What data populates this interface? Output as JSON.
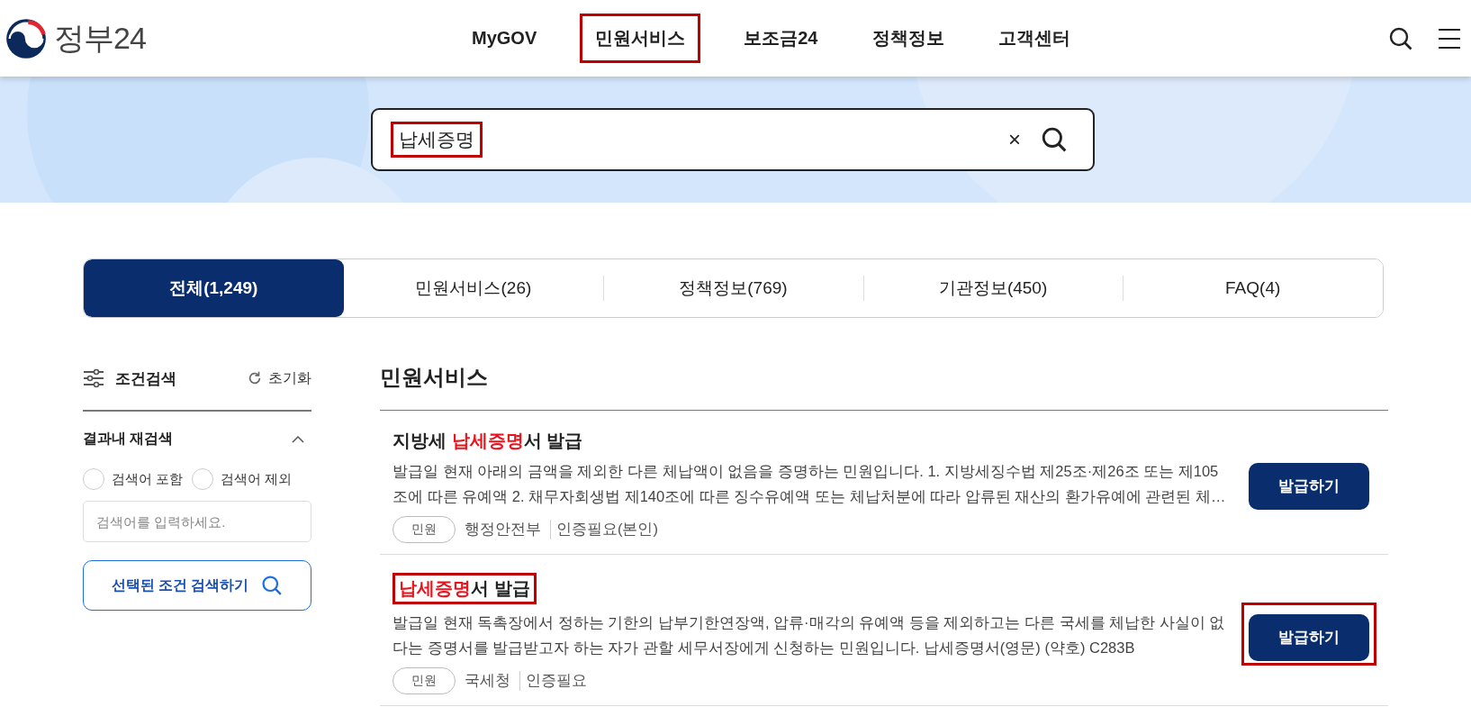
{
  "header": {
    "logo_text": "정부24",
    "nav": [
      {
        "label": "MyGOV",
        "highlighted": false
      },
      {
        "label": "민원서비스",
        "highlighted": true
      },
      {
        "label": "보조금24",
        "highlighted": false
      },
      {
        "label": "정책정보",
        "highlighted": false
      },
      {
        "label": "고객센터",
        "highlighted": false
      }
    ]
  },
  "search": {
    "value": "납세증명",
    "highlighted": true,
    "clear": "×"
  },
  "tabs": [
    {
      "label": "전체(1,249)",
      "selected": true
    },
    {
      "label": "민원서비스(26)",
      "selected": false
    },
    {
      "label": "정책정보(769)",
      "selected": false
    },
    {
      "label": "기관정보(450)",
      "selected": false
    },
    {
      "label": "FAQ(4)",
      "selected": false
    }
  ],
  "filter": {
    "title": "조건검색",
    "reset": "초기화",
    "section": "결과내 재검색",
    "expanded": true,
    "options": [
      {
        "label": "검색어 포함",
        "selected": false
      },
      {
        "label": "검색어 제외",
        "selected": false
      }
    ],
    "placeholder": "검색어를 입력하세요.",
    "button": "선택된 조건 검색하기"
  },
  "results": {
    "heading": "민원서비스",
    "items": [
      {
        "title": [
          {
            "text": "지방세 ",
            "match": false
          },
          {
            "text": "납세증명",
            "match": true
          },
          {
            "text": "서 발급",
            "match": false
          }
        ],
        "title_highlighted": false,
        "description": "발급일 현재 아래의 금액을 제외한 다른 체납액이 없음을 증명하는 민원입니다. 1. 지방세징수법 제25조·제26조 또는 제105조에 따른 유예액 2. 채무자회생법 제140조에 따른 징수유예액 또는 체납처분에 따라 압류된 재산의 환가유예에 관련된 체…",
        "tag": "민원",
        "agency": "행정안전부",
        "auth": "인증필요(본인)",
        "button": "발급하기",
        "button_highlighted": false
      },
      {
        "title": [
          {
            "text": "납세증명",
            "match": true
          },
          {
            "text": "서 발급",
            "match": false
          }
        ],
        "title_highlighted": true,
        "description": "발급일 현재 독촉장에서 정하는 기한의 납부기한연장액, 압류·매각의 유예액 등을 제외하고는 다른 국세를 체납한 사실이 없다는 증명서를 발급받고자 하는 자가 관할 세무서장에게 신청하는 민원입니다. 납세증명서(영문) (약호) C283B",
        "tag": "민원",
        "agency": "국세청",
        "auth": "인증필요",
        "button": "발급하기",
        "button_highlighted": true
      }
    ]
  }
}
